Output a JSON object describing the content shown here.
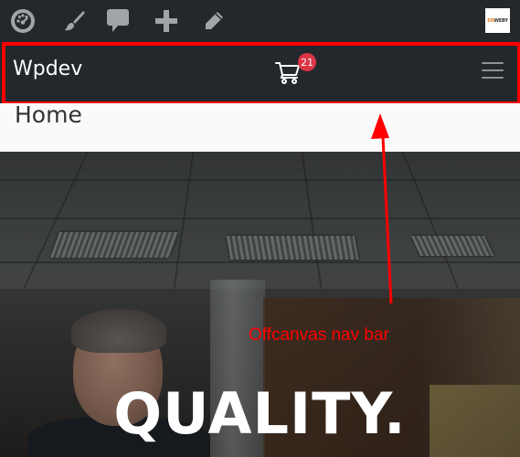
{
  "admin_bar": {
    "icons": [
      "dashboard-icon",
      "customize-brush-icon",
      "comments-icon",
      "new-content-plus-icon",
      "edit-pencil-icon"
    ],
    "avatar_text_accent": "EN",
    "avatar_text_rest": "WEBY"
  },
  "navbar": {
    "brand": "Wpdev",
    "cart_count": "21",
    "toggler_icon": "hamburger-menu-icon"
  },
  "page": {
    "title": "Home"
  },
  "hero": {
    "headline": "QUALITY."
  },
  "annotation": {
    "label": "Offcanvas nav bar",
    "color": "#ff0000"
  },
  "colors": {
    "admin_bar_bg": "#23282d",
    "badge": "#dc3545",
    "highlight": "#ff0000"
  }
}
